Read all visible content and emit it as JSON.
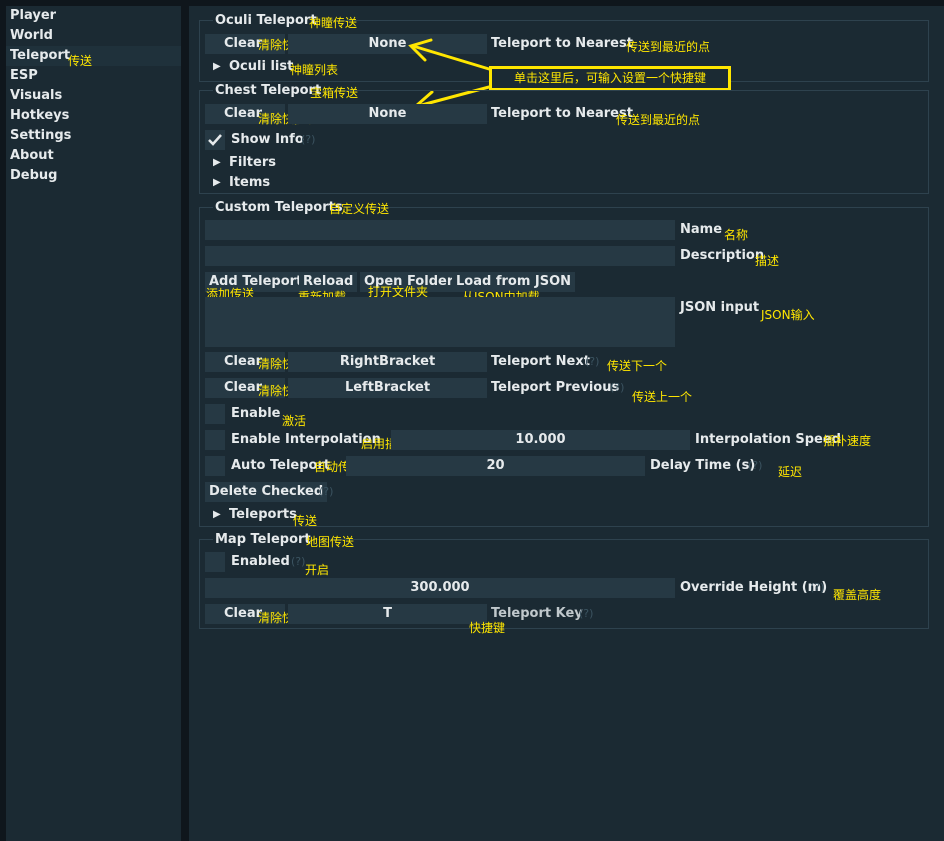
{
  "sidebar": {
    "items": [
      {
        "label": "Player"
      },
      {
        "label": "World"
      },
      {
        "label": "Teleport",
        "ann": "传送"
      },
      {
        "label": "ESP"
      },
      {
        "label": "Visuals"
      },
      {
        "label": "Hotkeys"
      },
      {
        "label": "Settings"
      },
      {
        "label": "About"
      },
      {
        "label": "Debug"
      }
    ]
  },
  "help_mark": "(?)",
  "oculi": {
    "title": "Oculi Teleport",
    "title_ann": "神瞳传送",
    "clear": "Clear",
    "clear_ann": "清除快捷键",
    "key": "None",
    "label": "Teleport to Nearest",
    "label_ann": "传送到最近的点",
    "list": "Oculi list",
    "list_ann": "神瞳列表"
  },
  "callout": "单击这里后，可输入设置一个快捷键",
  "chest": {
    "title": "Chest Teleport",
    "title_ann": "宝箱传送",
    "clear": "Clear",
    "clear_ann": "清除快捷键",
    "key": "None",
    "label": "Teleport to Nearest",
    "label_ann": "传送到最近的点",
    "show_info": "Show Info",
    "filters": "Filters",
    "items": "Items"
  },
  "custom": {
    "title": "Custom Teleports",
    "title_ann": "自定义传送",
    "name_label": "Name",
    "name_ann": "名称",
    "desc_label": "Description",
    "desc_ann": "描述",
    "add_btn": "Add Teleport",
    "add_ann": "添加传送",
    "reload_btn": "Reload",
    "reload_ann": "重新加载",
    "open_btn": "Open Folder",
    "open_ann": "打开文件夹",
    "load_btn": "Load from JSON",
    "load_ann": "从JSON中加载",
    "json_label": "JSON input",
    "json_ann": "JSON输入",
    "next_clear": "Clear",
    "next_clear_ann": "清除快捷键",
    "next_key": "RightBracket",
    "next_label": "Teleport Next",
    "next_ann": "传送下一个",
    "prev_clear": "Clear",
    "prev_clear_ann": "清除快捷键",
    "prev_key": "LeftBracket",
    "prev_label": "Teleport Previous",
    "prev_ann": "传送上一个",
    "enable": "Enable",
    "enable_ann": "激活",
    "interp": "Enable Interpolation",
    "interp_ann": "启用插值",
    "interp_value": "10.000",
    "interp_speed": "Interpolation Speed",
    "interp_speed_ann": "插补速度",
    "auto": "Auto Teleport",
    "auto_ann": "自动传送",
    "delay_value": "20",
    "delay_label": "Delay Time (s)",
    "delay_ann": "延迟",
    "delete_btn": "Delete Checked",
    "teleports": "Teleports",
    "teleports_ann": "传送"
  },
  "map": {
    "title": "Map Teleport",
    "title_ann": "地图传送",
    "enabled": "Enabled",
    "enabled_ann": "开启",
    "height_value": "300.000",
    "height_label": "Override Height (m)",
    "height_ann": "覆盖高度",
    "clear": "Clear",
    "clear_ann": "清除快捷键",
    "key": "T",
    "key_label": "Teleport Key",
    "key_ann": "快捷键"
  },
  "colors": {
    "annotation": "#ffe600",
    "panel": "#1b2a33",
    "widget": "#263944"
  }
}
